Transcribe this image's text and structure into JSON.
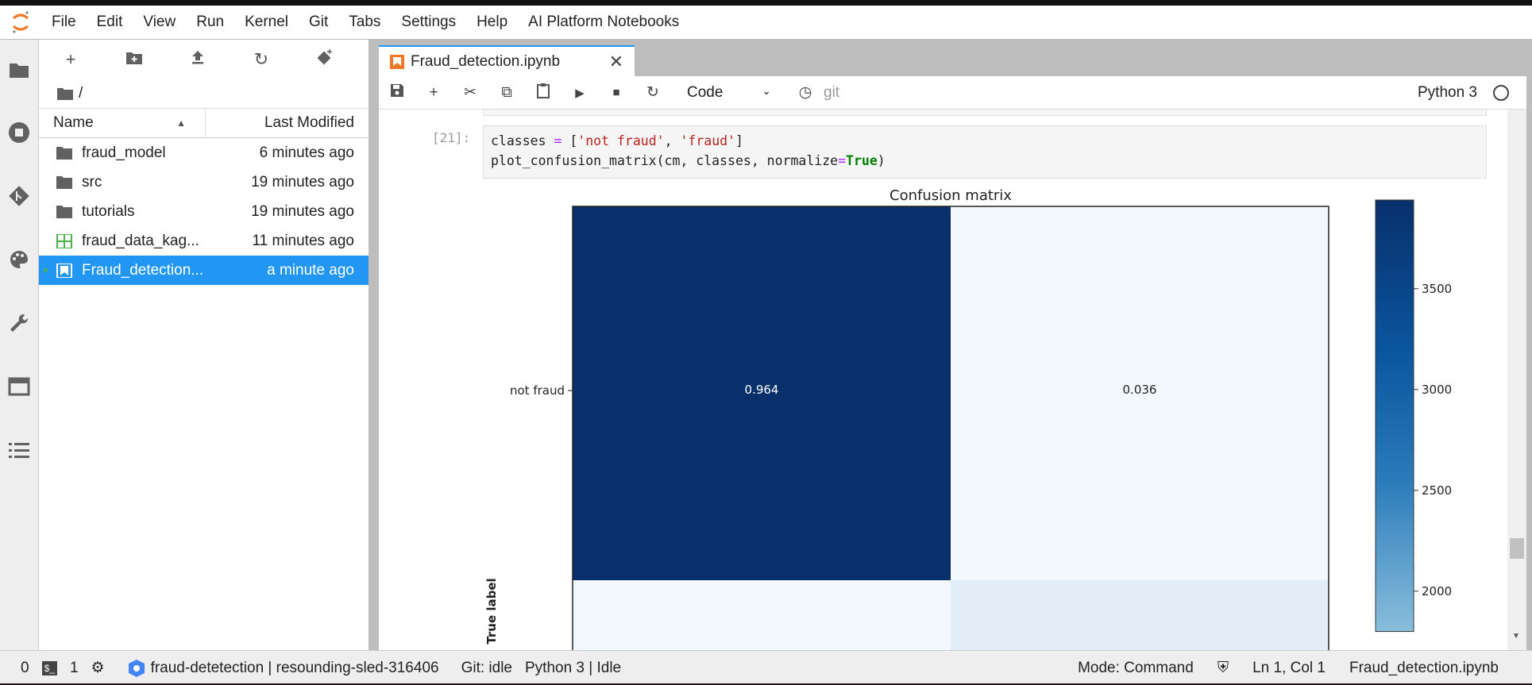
{
  "menu": [
    "File",
    "Edit",
    "View",
    "Run",
    "Kernel",
    "Git",
    "Tabs",
    "Settings",
    "Help",
    "AI Platform Notebooks"
  ],
  "filebrowser": {
    "path": "/",
    "col_name": "Name",
    "col_modified": "Last Modified",
    "items": [
      {
        "name": "fraud_model",
        "modified": "6 minutes ago",
        "type": "folder"
      },
      {
        "name": "src",
        "modified": "19 minutes ago",
        "type": "folder"
      },
      {
        "name": "tutorials",
        "modified": "19 minutes ago",
        "type": "folder"
      },
      {
        "name": "fraud_data_kag...",
        "modified": "11 minutes ago",
        "type": "csv"
      },
      {
        "name": "Fraud_detection...",
        "modified": "a minute ago",
        "type": "notebook",
        "selected": true
      }
    ]
  },
  "tab": {
    "title": "Fraud_detection.ipynb"
  },
  "toolbar": {
    "cell_type": "Code",
    "git": "git",
    "kernel": "Python 3"
  },
  "cell": {
    "prompt": "[21]:",
    "line1_a": "classes ",
    "line1_eq": "=",
    "line1_b": " [",
    "s1": "'not fraud'",
    "comma": ", ",
    "s2": "'fraud'",
    "line1_c": "]",
    "line2_a": "plot_confusion_matrix(cm, classes, normalize",
    "line2_eq": "=",
    "line2_kw": "True",
    "line2_c": ")"
  },
  "chart_data": {
    "type": "heatmap",
    "title": "Confusion matrix",
    "ylabel": "True label",
    "y_categories": [
      "not fraud"
    ],
    "cells": [
      [
        "0.964",
        "0.036"
      ]
    ],
    "colorbar": {
      "ticks": [
        "3500",
        "3000",
        "2500",
        "2000"
      ],
      "tick_values": [
        3500,
        3000,
        2500,
        2000
      ],
      "range": [
        1800,
        3940
      ]
    },
    "colors": {
      "dark": "#08306b",
      "light": "#f3f8fd",
      "light2": "#e2edf8"
    }
  },
  "status": {
    "terminals": "0",
    "kernels": "1",
    "env": "fraud-detetection | resounding-sled-316406",
    "git": "Git: idle",
    "kernel": "Python 3 | Idle",
    "mode": "Mode: Command",
    "cursor": "Ln 1, Col 1",
    "file": "Fraud_detection.ipynb"
  }
}
